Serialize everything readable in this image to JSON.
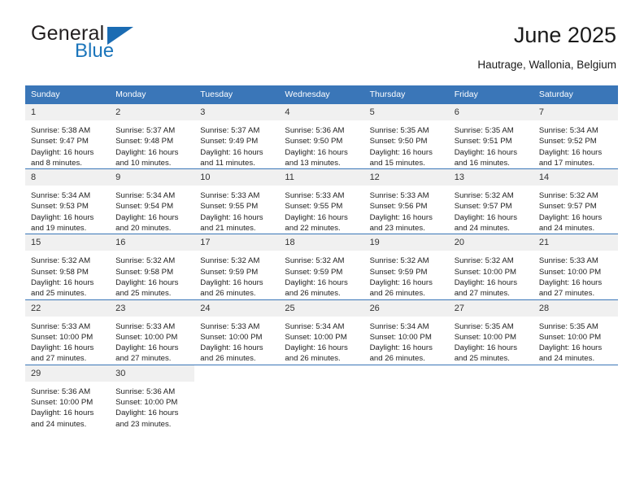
{
  "brand": {
    "name_top": "General",
    "name_bottom": "Blue",
    "triangle_icon": "blue-triangle-icon",
    "accent_color": "#1b75bb"
  },
  "header": {
    "title": "June 2025",
    "subtitle": "Hautrage, Wallonia, Belgium"
  },
  "theme": {
    "header_row_bg": "#3a76b8",
    "daynum_bg": "#f0f0f0",
    "text_color": "#222222"
  },
  "calendar": {
    "weekday_headers": [
      "Sunday",
      "Monday",
      "Tuesday",
      "Wednesday",
      "Thursday",
      "Friday",
      "Saturday"
    ],
    "weeks": [
      [
        {
          "day": "1",
          "sunrise": "Sunrise: 5:38 AM",
          "sunset": "Sunset: 9:47 PM",
          "daylight_line1": "Daylight: 16 hours",
          "daylight_line2": "and 8 minutes."
        },
        {
          "day": "2",
          "sunrise": "Sunrise: 5:37 AM",
          "sunset": "Sunset: 9:48 PM",
          "daylight_line1": "Daylight: 16 hours",
          "daylight_line2": "and 10 minutes."
        },
        {
          "day": "3",
          "sunrise": "Sunrise: 5:37 AM",
          "sunset": "Sunset: 9:49 PM",
          "daylight_line1": "Daylight: 16 hours",
          "daylight_line2": "and 11 minutes."
        },
        {
          "day": "4",
          "sunrise": "Sunrise: 5:36 AM",
          "sunset": "Sunset: 9:50 PM",
          "daylight_line1": "Daylight: 16 hours",
          "daylight_line2": "and 13 minutes."
        },
        {
          "day": "5",
          "sunrise": "Sunrise: 5:35 AM",
          "sunset": "Sunset: 9:50 PM",
          "daylight_line1": "Daylight: 16 hours",
          "daylight_line2": "and 15 minutes."
        },
        {
          "day": "6",
          "sunrise": "Sunrise: 5:35 AM",
          "sunset": "Sunset: 9:51 PM",
          "daylight_line1": "Daylight: 16 hours",
          "daylight_line2": "and 16 minutes."
        },
        {
          "day": "7",
          "sunrise": "Sunrise: 5:34 AM",
          "sunset": "Sunset: 9:52 PM",
          "daylight_line1": "Daylight: 16 hours",
          "daylight_line2": "and 17 minutes."
        }
      ],
      [
        {
          "day": "8",
          "sunrise": "Sunrise: 5:34 AM",
          "sunset": "Sunset: 9:53 PM",
          "daylight_line1": "Daylight: 16 hours",
          "daylight_line2": "and 19 minutes."
        },
        {
          "day": "9",
          "sunrise": "Sunrise: 5:34 AM",
          "sunset": "Sunset: 9:54 PM",
          "daylight_line1": "Daylight: 16 hours",
          "daylight_line2": "and 20 minutes."
        },
        {
          "day": "10",
          "sunrise": "Sunrise: 5:33 AM",
          "sunset": "Sunset: 9:55 PM",
          "daylight_line1": "Daylight: 16 hours",
          "daylight_line2": "and 21 minutes."
        },
        {
          "day": "11",
          "sunrise": "Sunrise: 5:33 AM",
          "sunset": "Sunset: 9:55 PM",
          "daylight_line1": "Daylight: 16 hours",
          "daylight_line2": "and 22 minutes."
        },
        {
          "day": "12",
          "sunrise": "Sunrise: 5:33 AM",
          "sunset": "Sunset: 9:56 PM",
          "daylight_line1": "Daylight: 16 hours",
          "daylight_line2": "and 23 minutes."
        },
        {
          "day": "13",
          "sunrise": "Sunrise: 5:32 AM",
          "sunset": "Sunset: 9:57 PM",
          "daylight_line1": "Daylight: 16 hours",
          "daylight_line2": "and 24 minutes."
        },
        {
          "day": "14",
          "sunrise": "Sunrise: 5:32 AM",
          "sunset": "Sunset: 9:57 PM",
          "daylight_line1": "Daylight: 16 hours",
          "daylight_line2": "and 24 minutes."
        }
      ],
      [
        {
          "day": "15",
          "sunrise": "Sunrise: 5:32 AM",
          "sunset": "Sunset: 9:58 PM",
          "daylight_line1": "Daylight: 16 hours",
          "daylight_line2": "and 25 minutes."
        },
        {
          "day": "16",
          "sunrise": "Sunrise: 5:32 AM",
          "sunset": "Sunset: 9:58 PM",
          "daylight_line1": "Daylight: 16 hours",
          "daylight_line2": "and 25 minutes."
        },
        {
          "day": "17",
          "sunrise": "Sunrise: 5:32 AM",
          "sunset": "Sunset: 9:59 PM",
          "daylight_line1": "Daylight: 16 hours",
          "daylight_line2": "and 26 minutes."
        },
        {
          "day": "18",
          "sunrise": "Sunrise: 5:32 AM",
          "sunset": "Sunset: 9:59 PM",
          "daylight_line1": "Daylight: 16 hours",
          "daylight_line2": "and 26 minutes."
        },
        {
          "day": "19",
          "sunrise": "Sunrise: 5:32 AM",
          "sunset": "Sunset: 9:59 PM",
          "daylight_line1": "Daylight: 16 hours",
          "daylight_line2": "and 26 minutes."
        },
        {
          "day": "20",
          "sunrise": "Sunrise: 5:32 AM",
          "sunset": "Sunset: 10:00 PM",
          "daylight_line1": "Daylight: 16 hours",
          "daylight_line2": "and 27 minutes."
        },
        {
          "day": "21",
          "sunrise": "Sunrise: 5:33 AM",
          "sunset": "Sunset: 10:00 PM",
          "daylight_line1": "Daylight: 16 hours",
          "daylight_line2": "and 27 minutes."
        }
      ],
      [
        {
          "day": "22",
          "sunrise": "Sunrise: 5:33 AM",
          "sunset": "Sunset: 10:00 PM",
          "daylight_line1": "Daylight: 16 hours",
          "daylight_line2": "and 27 minutes."
        },
        {
          "day": "23",
          "sunrise": "Sunrise: 5:33 AM",
          "sunset": "Sunset: 10:00 PM",
          "daylight_line1": "Daylight: 16 hours",
          "daylight_line2": "and 27 minutes."
        },
        {
          "day": "24",
          "sunrise": "Sunrise: 5:33 AM",
          "sunset": "Sunset: 10:00 PM",
          "daylight_line1": "Daylight: 16 hours",
          "daylight_line2": "and 26 minutes."
        },
        {
          "day": "25",
          "sunrise": "Sunrise: 5:34 AM",
          "sunset": "Sunset: 10:00 PM",
          "daylight_line1": "Daylight: 16 hours",
          "daylight_line2": "and 26 minutes."
        },
        {
          "day": "26",
          "sunrise": "Sunrise: 5:34 AM",
          "sunset": "Sunset: 10:00 PM",
          "daylight_line1": "Daylight: 16 hours",
          "daylight_line2": "and 26 minutes."
        },
        {
          "day": "27",
          "sunrise": "Sunrise: 5:35 AM",
          "sunset": "Sunset: 10:00 PM",
          "daylight_line1": "Daylight: 16 hours",
          "daylight_line2": "and 25 minutes."
        },
        {
          "day": "28",
          "sunrise": "Sunrise: 5:35 AM",
          "sunset": "Sunset: 10:00 PM",
          "daylight_line1": "Daylight: 16 hours",
          "daylight_line2": "and 24 minutes."
        }
      ],
      [
        {
          "day": "29",
          "sunrise": "Sunrise: 5:36 AM",
          "sunset": "Sunset: 10:00 PM",
          "daylight_line1": "Daylight: 16 hours",
          "daylight_line2": "and 24 minutes."
        },
        {
          "day": "30",
          "sunrise": "Sunrise: 5:36 AM",
          "sunset": "Sunset: 10:00 PM",
          "daylight_line1": "Daylight: 16 hours",
          "daylight_line2": "and 23 minutes."
        },
        {
          "day": "",
          "sunrise": "",
          "sunset": "",
          "daylight_line1": "",
          "daylight_line2": ""
        },
        {
          "day": "",
          "sunrise": "",
          "sunset": "",
          "daylight_line1": "",
          "daylight_line2": ""
        },
        {
          "day": "",
          "sunrise": "",
          "sunset": "",
          "daylight_line1": "",
          "daylight_line2": ""
        },
        {
          "day": "",
          "sunrise": "",
          "sunset": "",
          "daylight_line1": "",
          "daylight_line2": ""
        },
        {
          "day": "",
          "sunrise": "",
          "sunset": "",
          "daylight_line1": "",
          "daylight_line2": ""
        }
      ]
    ]
  }
}
